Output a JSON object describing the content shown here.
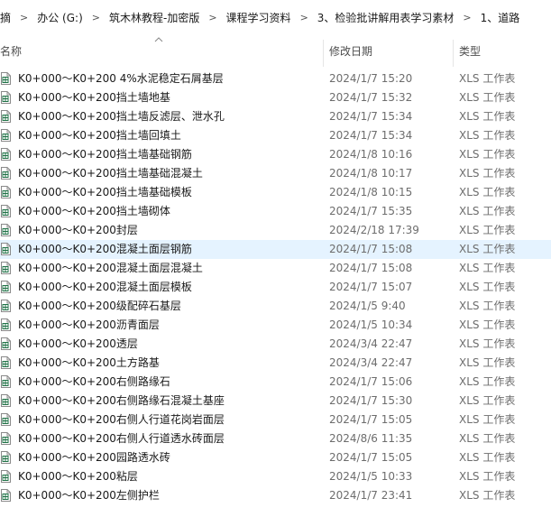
{
  "breadcrumb": {
    "items": [
      "摘",
      "办公 (G:)",
      "筑木林教程-加密版",
      "课程学习资料",
      "3、检验批讲解用表学习素材",
      "1、道路"
    ],
    "separator": ">"
  },
  "columns": {
    "name": "名称",
    "date": "修改日期",
    "type": "类型"
  },
  "file_icon": "excel-file-icon",
  "colors": {
    "selected_row": "#e5f3ff",
    "icon_green": "#1e7145"
  },
  "files": [
    {
      "name": "K0+000～K0+200 4%水泥稳定石屑基层",
      "date": "2024/1/7 15:20",
      "type": "XLS 工作表"
    },
    {
      "name": "K0+000～K0+200挡土墙地基",
      "date": "2024/1/7 15:32",
      "type": "XLS 工作表"
    },
    {
      "name": "K0+000～K0+200挡土墙反滤层、泄水孔",
      "date": "2024/1/7 15:34",
      "type": "XLS 工作表"
    },
    {
      "name": "K0+000～K0+200挡土墙回填土",
      "date": "2024/1/7 15:34",
      "type": "XLS 工作表"
    },
    {
      "name": "K0+000～K0+200挡土墙基础钢筋",
      "date": "2024/1/8 10:16",
      "type": "XLS 工作表"
    },
    {
      "name": "K0+000～K0+200挡土墙基础混凝土",
      "date": "2024/1/8 10:17",
      "type": "XLS 工作表"
    },
    {
      "name": "K0+000～K0+200挡土墙基础模板",
      "date": "2024/1/8 10:15",
      "type": "XLS 工作表"
    },
    {
      "name": "K0+000～K0+200挡土墙砌体",
      "date": "2024/1/7 15:35",
      "type": "XLS 工作表"
    },
    {
      "name": "K0+000～K0+200封层",
      "date": "2024/2/18 17:39",
      "type": "XLS 工作表"
    },
    {
      "name": "K0+000～K0+200混凝土面层钢筋",
      "date": "2024/1/7 15:08",
      "type": "XLS 工作表",
      "selected": true
    },
    {
      "name": "K0+000～K0+200混凝土面层混凝土",
      "date": "2024/1/7 15:08",
      "type": "XLS 工作表"
    },
    {
      "name": "K0+000～K0+200混凝土面层模板",
      "date": "2024/1/7 15:07",
      "type": "XLS 工作表"
    },
    {
      "name": "K0+000～K0+200级配碎石基层",
      "date": "2024/1/5 9:40",
      "type": "XLS 工作表"
    },
    {
      "name": "K0+000～K0+200沥青面层",
      "date": "2024/1/5 10:34",
      "type": "XLS 工作表"
    },
    {
      "name": "K0+000～K0+200透层",
      "date": "2024/3/4 22:47",
      "type": "XLS 工作表"
    },
    {
      "name": "K0+000～K0+200土方路基",
      "date": "2024/3/4 22:47",
      "type": "XLS 工作表"
    },
    {
      "name": "K0+000～K0+200右侧路缘石",
      "date": "2024/1/7 15:06",
      "type": "XLS 工作表"
    },
    {
      "name": "K0+000～K0+200右侧路缘石混凝土基座",
      "date": "2024/1/7 15:30",
      "type": "XLS 工作表"
    },
    {
      "name": "K0+000～K0+200右侧人行道花岗岩面层",
      "date": "2024/1/7 15:05",
      "type": "XLS 工作表"
    },
    {
      "name": "K0+000～K0+200右侧人行道透水砖面层",
      "date": "2024/8/6 11:35",
      "type": "XLS 工作表"
    },
    {
      "name": "K0+000～K0+200园路透水砖",
      "date": "2024/1/7 15:05",
      "type": "XLS 工作表"
    },
    {
      "name": "K0+000～K0+200粘层",
      "date": "2024/1/5 10:33",
      "type": "XLS 工作表"
    },
    {
      "name": "K0+000～K0+200左侧护栏",
      "date": "2024/1/7 23:41",
      "type": "XLS 工作表"
    }
  ]
}
